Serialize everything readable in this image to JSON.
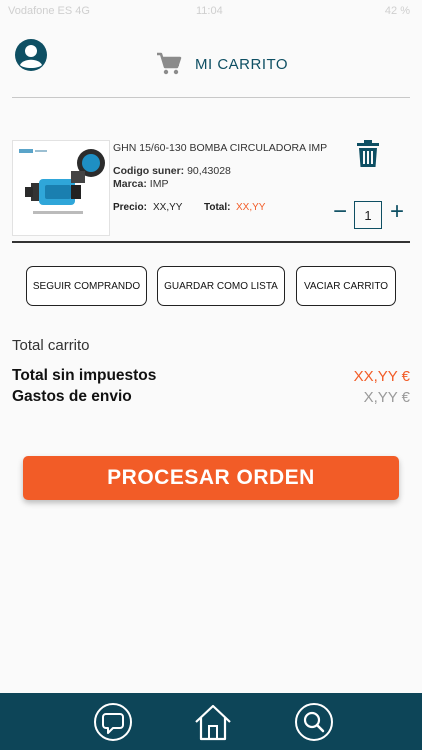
{
  "status_bar": {
    "carrier": "Vodafone ES  4G",
    "time": "11:04",
    "battery": "42 %"
  },
  "header": {
    "title": "MI CARRITO"
  },
  "item": {
    "name": "GHN 15/60-130  BOMBA CIRCULADORA IMP",
    "code_label": "Codigo suner:",
    "code_value": "90,43028",
    "brand_label": "Marca:",
    "brand_value": "IMP",
    "price_label": "Precio:",
    "price_value": "XX,YY",
    "total_label": "Total:",
    "total_value": "XX,YY",
    "quantity": "1",
    "qty_minus": "−",
    "qty_plus": "+"
  },
  "actions": {
    "continue": "SEGUIR COMPRANDO",
    "save_list": "GUARDAR COMO LISTA",
    "empty_cart": "VACIAR CARRITO"
  },
  "summary": {
    "title": "Total carrito",
    "subtotal_label": "Total sin impuestos",
    "subtotal_value": "XX,YY €",
    "shipping_label": "Gastos de envio",
    "shipping_value": "X,YY €"
  },
  "process_button": "PROCESAR ORDEN",
  "bottom_nav": {
    "icons": [
      "chat-icon",
      "home-icon",
      "search-icon"
    ]
  },
  "colors": {
    "accent_orange": "#f25c27",
    "brand_teal": "#0e4f63",
    "nav_bg": "#0d4558",
    "muted_value": "#9a9a9a"
  }
}
